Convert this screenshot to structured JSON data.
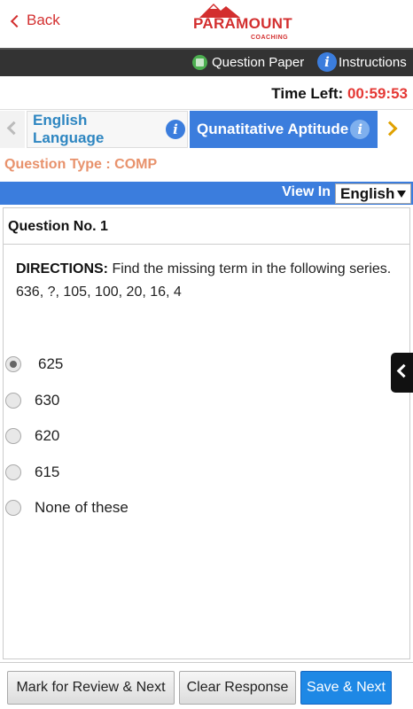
{
  "header": {
    "back_label": "Back",
    "logo_text": "PARAMOUNT",
    "logo_sub": "COACHING",
    "brand_color": "#d32f2f"
  },
  "toolbar": {
    "question_paper_label": "Question Paper",
    "instructions_label": "Instructions"
  },
  "timer": {
    "label": "Time Left: ",
    "value": "00:59:53"
  },
  "subjects": {
    "tabs": [
      {
        "label": "English Language",
        "active": false
      },
      {
        "label": "Qunatitative Aptitude",
        "active": true
      }
    ]
  },
  "question_type": "Question Type : COMP",
  "view_in": {
    "label": "View In",
    "selected_language": "English"
  },
  "question": {
    "number_label": "Question No. 1",
    "directions_label": "DIRECTIONS:",
    "directions_text": " Find the missing term in the following series.",
    "series": "636, ?, 105, 100, 20, 16, 4",
    "options": [
      {
        "label": "625",
        "selected": true
      },
      {
        "label": "630",
        "selected": false
      },
      {
        "label": "620",
        "selected": false
      },
      {
        "label": "615",
        "selected": false
      },
      {
        "label": "None of these",
        "selected": false
      }
    ]
  },
  "actions": {
    "mark_review_label": "Mark for Review & Next",
    "clear_label": "Clear Response",
    "save_next_label": "Save & Next"
  },
  "colors": {
    "accent_blue": "#3b7ddd",
    "timer_red": "#e53935",
    "question_type_orange": "#e8926c",
    "arrow_gold": "#e0a100"
  }
}
